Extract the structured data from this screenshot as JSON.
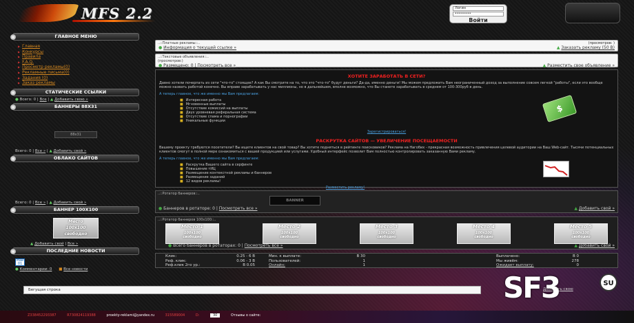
{
  "header": {
    "logo": "MFS 2.2",
    "login": {
      "login_value": "Логин",
      "password_value": "••••••••",
      "enter_label": "Войти"
    }
  },
  "sidebar": {
    "main_menu_title": "ГЛАВНОЕ МЕНЮ",
    "menu_items": [
      "Главная",
      "Конкурсы",
      "Правила",
      "F.A.Q.",
      "Просмотр рекламы(0)",
      "Рекламные письма(0)",
      "Задания (0)",
      "Заказ рекламы"
    ],
    "static_links_title": "СТАТИЧЕСКИЕ ССЫЛКИ",
    "static_links_line": {
      "total": "Всего: 0 |",
      "all": "Все",
      "add": "Добавить свою »"
    },
    "banners88_title": "БАННЕРЫ 88X31",
    "banner88_text": "88x31",
    "banners88_line": {
      "total": "Всего: 0 |",
      "all": "Все »",
      "add": "Добавить свой »"
    },
    "cloud_title": "ОБЛАКО САЙТОВ",
    "cloud_line": {
      "total": "Всего: 0 |",
      "all": "Все »",
      "add": "Добавить свой »"
    },
    "banner100_title": "БАННЕР 100X100",
    "banner100_text": {
      "place": "Место",
      "size": "100x100",
      "status": "свободно"
    },
    "banner100_line": {
      "add": "Добавить свой",
      "all": "Все »"
    },
    "news_title": "ПОСЛЕДНИЕ НОВОСТИ",
    "news_date": {
      "month": "Май",
      "day": "01"
    },
    "news_line": {
      "comments": "Комментарии: 0",
      "all": "Все новости"
    }
  },
  "main": {
    "paid_ads": {
      "title": "..::Платные рекламы::..",
      "views": "(просмотров: )",
      "info_link": "Информация о текущей ссылке »",
      "order_link": "Заказать рекламу (50 В)"
    },
    "text_ads": {
      "title": "..::Текстовые объявления::..",
      "views": "(просмотров:)",
      "placed": "Размещено: 0 |",
      "view_all": "Посмотреть все »",
      "place_link": "Разместить свое объявление »"
    },
    "offer": {
      "heading1": "ХОТИТЕ ЗАРАБОТАТЬ В СЕТИ?",
      "para1": "Давно хотели почерпать из сети \"что-то\" стоящее? А как Вы смотрите на то, что это \"что-то\" будут деньги? Да-да, именно деньги! Мы можем предложить Вам неограниченный доход за выполнение совсем легкой \"работы\", если это вообще можно назвать работой конечно. Вы вправе зарабатывать у нас миллионы, но в дальнейшем, вполне возможно, что Вы станете зарабатывать в среднем от 100-300руб в день.",
      "sub1": "А теперь главное, что же именно мы Вам предлагаем:",
      "list1": [
        "Интересная работа",
        "Мгновенные выплаты",
        "Отсутствие комиссий на выплаты",
        "Двух уровневая реферальная система",
        "Отсутствие спама и порнографии",
        "Уникальные функции"
      ],
      "register_link": "Зарегистрироваться!",
      "heading2": "РАСКРУТКА САЙТОВ — УВЕЛИЧЕНИЕ ПОСЕЩАЕМОСТИ",
      "para2": "Вашему проекту требуются посетители? Вы ищете клиентов на свой товар? Вы хотите подняться в рейтинге поисковиков? Реклама на Нагобих - прекрасная возможность привлечения целевой аудитории на Ваш Web-сайт. Тысячи потенциальных клиентов смогут в полной мере ознакомиться с вашей продукцией или услугами. Удобный интерфейс позволит Вам полностью контролировать заказанную Вами рекламу.",
      "sub2": "А теперь главное, что же именно мы Вам предлагаем:",
      "list2": [
        "Раскрутка Вашего сайта в серфинге",
        "Повышение тИЦ",
        "Размещение контекстной рекламы и баннеров",
        "Размещение заданий",
        "12 видов рекламы!"
      ],
      "ad_link": "Разместить рекламу!"
    },
    "rotator1": {
      "title": "..::Ротатор баннеров::..",
      "banner_text": "BANNER",
      "count": "Баннеров в ротаторе: 0 |",
      "view_all": "Посмотреть все »",
      "add": "Добавить свой »"
    },
    "rotator2": {
      "title": "..::Ротатор баннеров 100x100::..",
      "slots": [
        {
          "place": "Место 1",
          "size": "100x100",
          "status": "свободно"
        },
        {
          "place": "Место 2",
          "size": "100x100",
          "status": "свободно"
        },
        {
          "place": "Место 3",
          "size": "100x100",
          "status": "свободно"
        },
        {
          "place": "Место 4",
          "size": "100x100",
          "status": "свободно"
        },
        {
          "place": "Место 5",
          "size": "100x100",
          "status": "свободно"
        }
      ],
      "count": "Всего баннеров в ротаторах: 0 |",
      "view_all": "Посмотреть все »",
      "add": "Добавить свой »"
    },
    "stats": {
      "click_label": "Клик:",
      "click_value": "0.25 - 6 В",
      "refclick_label": "Реф. клик:",
      "refclick_value": "0.06 - 3 В",
      "ref2_label": "Реф.клик 2го ур.:",
      "ref2_value": "В 0.05",
      "minpay_label": "Мин. к выплате:",
      "minpay_value": "В 30",
      "users_label": "Пользователей:",
      "users_value": "1",
      "online_label": "Онлайн:",
      "online_value": "1",
      "paid_label": "Выплачено:",
      "paid_value": "В 0",
      "alive_label": "Мы живём:",
      "alive_value": "278",
      "pending_label": "Ожидает выплату:",
      "pending_value": "0"
    }
  },
  "ticker": {
    "label": "Бегущая строка"
  },
  "bottom_add_link": "Добавить свою",
  "footer": {
    "items": [
      "Z338452293387",
      "R730824119388",
      "proekty-reklami@yandex.ru",
      "315589004",
      "D:"
    ],
    "counter": "30",
    "reviews": "Отзывы о сайте:"
  },
  "brand": {
    "sf": "SF3",
    "su": "SU"
  },
  "colors": {
    "menu_link": "#d88a20",
    "heading_red": "#f02020",
    "link_blue": "#4aa0e0",
    "ok_green": "#44aa44"
  }
}
